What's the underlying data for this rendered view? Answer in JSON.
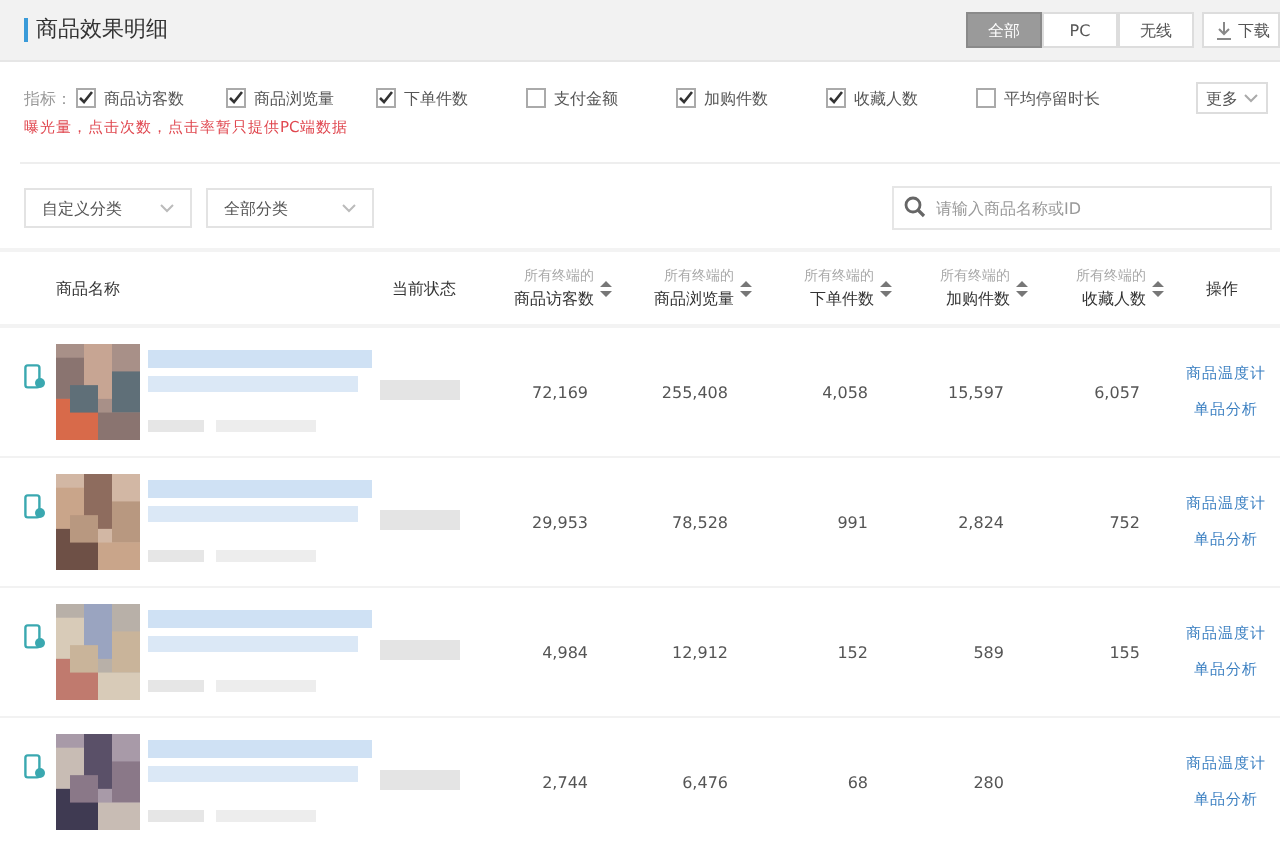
{
  "header": {
    "title": "商品效果明细",
    "segments": [
      {
        "label": "全部",
        "selected": true
      },
      {
        "label": "PC",
        "selected": false
      },
      {
        "label": "无线",
        "selected": false
      }
    ],
    "download": "下载"
  },
  "metrics": {
    "label": "指标：",
    "items": [
      {
        "label": "商品访客数",
        "checked": true
      },
      {
        "label": "商品浏览量",
        "checked": true
      },
      {
        "label": "下单件数",
        "checked": true
      },
      {
        "label": "支付金额",
        "checked": false
      },
      {
        "label": "加购件数",
        "checked": true
      },
      {
        "label": "收藏人数",
        "checked": true
      },
      {
        "label": "平均停留时长",
        "checked": false
      }
    ],
    "more": "更多",
    "notice": "曝光量，点击次数，点击率暂只提供PC端数据"
  },
  "filters": {
    "dropdowns": [
      "自定义分类",
      "全部分类"
    ],
    "search": {
      "placeholder": "请输入商品名称或ID"
    }
  },
  "table": {
    "columns": [
      {
        "label": "商品名称"
      },
      {
        "label": "当前状态"
      },
      {
        "prefix": "所有终端的",
        "label": "商品访客数"
      },
      {
        "prefix": "所有终端的",
        "label": "商品浏览量"
      },
      {
        "prefix": "所有终端的",
        "label": "下单件数"
      },
      {
        "prefix": "所有终端的",
        "label": "加购件数"
      },
      {
        "prefix": "所有终端的",
        "label": "收藏人数"
      },
      {
        "label": "操作"
      }
    ],
    "rows": [
      {
        "values": [
          "72,169",
          "255,408",
          "4,058",
          "15,597",
          "6,057"
        ],
        "actions": [
          "商品温度计",
          "单品分析"
        ]
      },
      {
        "values": [
          "29,953",
          "78,528",
          "991",
          "2,824",
          "752"
        ],
        "actions": [
          "商品温度计",
          "单品分析"
        ]
      },
      {
        "values": [
          "4,984",
          "12,912",
          "152",
          "589",
          "155"
        ],
        "actions": [
          "商品温度计",
          "单品分析"
        ]
      },
      {
        "values": [
          "2,744",
          "6,476",
          "68",
          "280"
        ],
        "actions": [
          "商品温度计",
          "单品分析"
        ]
      }
    ]
  }
}
